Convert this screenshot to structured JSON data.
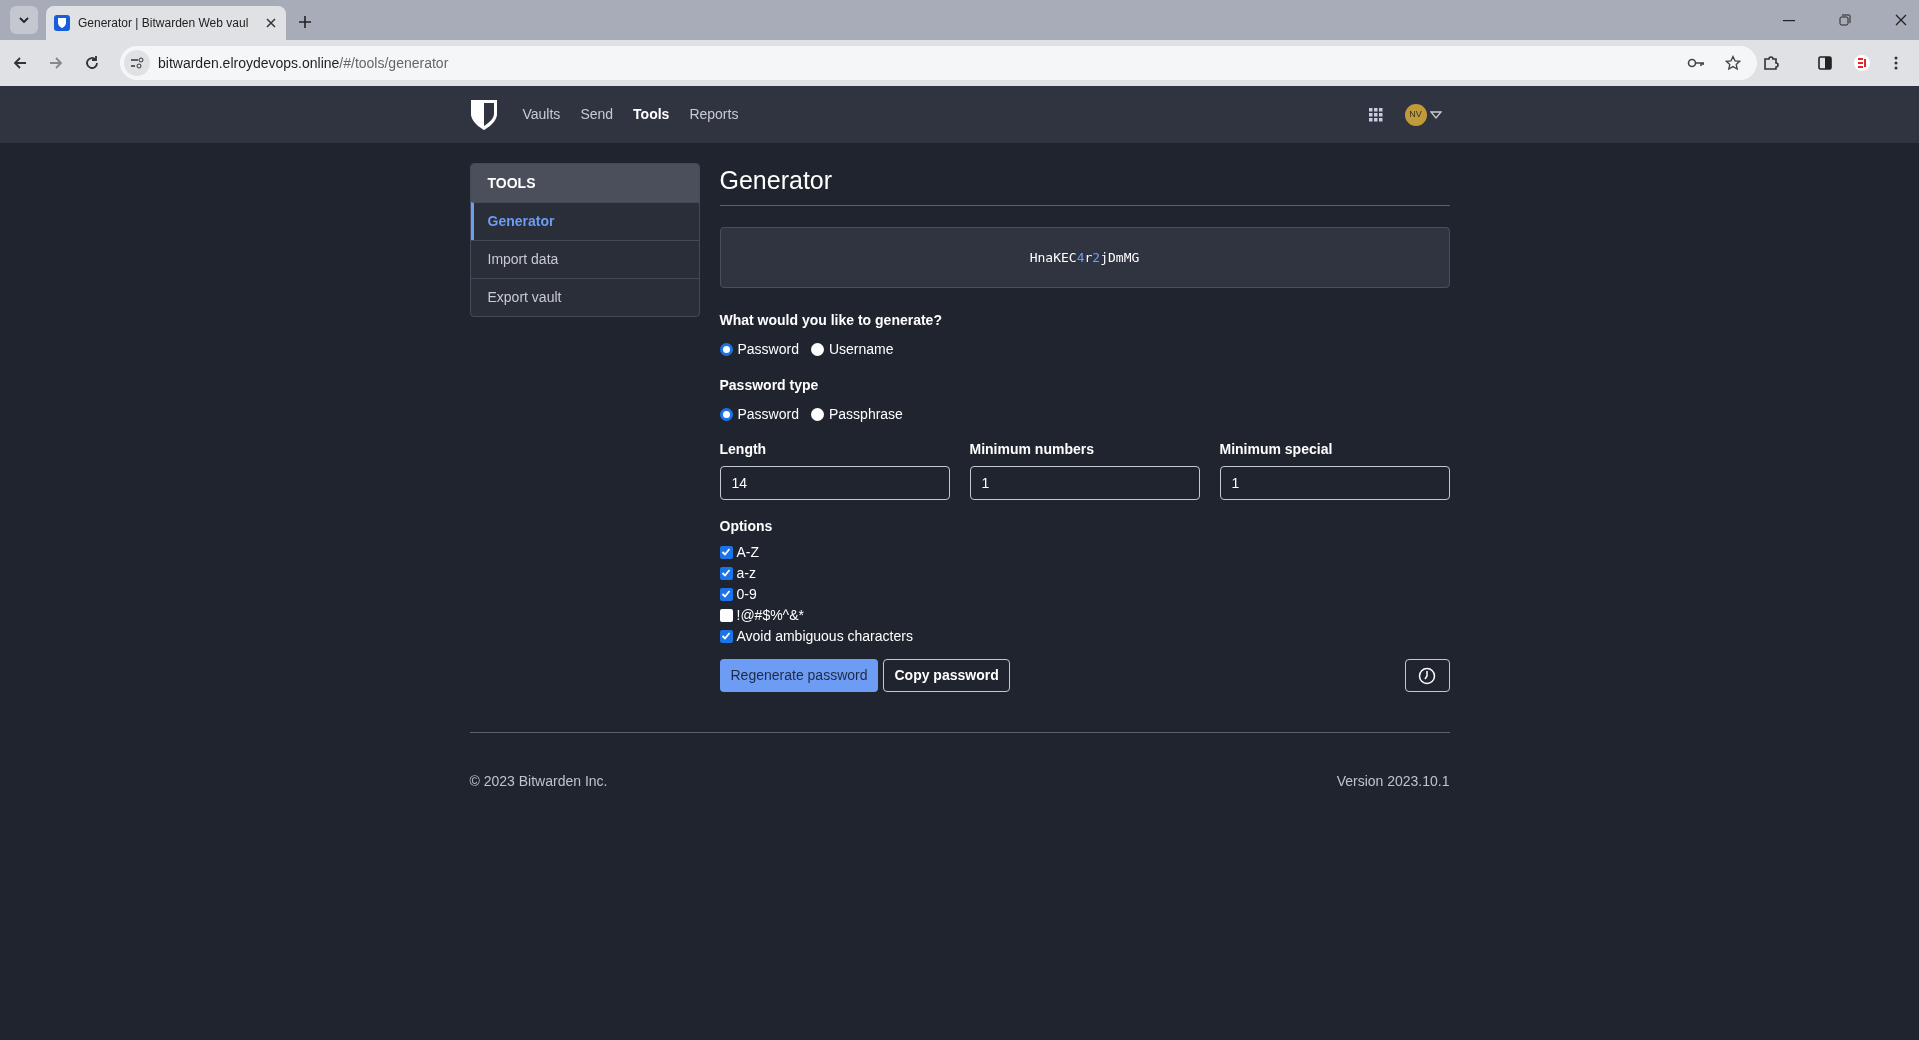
{
  "browser": {
    "tab_title": "Generator | Bitwarden Web vaul",
    "url_host": "bitwarden.elroydevops.online",
    "url_path": "/#/tools/generator"
  },
  "nav": {
    "items": [
      {
        "label": "Vaults",
        "selected": false
      },
      {
        "label": "Send",
        "selected": false
      },
      {
        "label": "Tools",
        "selected": true
      },
      {
        "label": "Reports",
        "selected": false
      }
    ],
    "avatar": "NV"
  },
  "sidebar": {
    "title": "TOOLS",
    "items": [
      {
        "label": "Generator",
        "selected": true
      },
      {
        "label": "Import data",
        "selected": false
      },
      {
        "label": "Export vault",
        "selected": false
      }
    ]
  },
  "page_title": "Generator",
  "generated_password": "HnaKEC4r2jDmMG",
  "generate_question": "What would you like to generate?",
  "generate_options": [
    {
      "label": "Password",
      "selected": true
    },
    {
      "label": "Username",
      "selected": false
    }
  ],
  "password_type_label": "Password type",
  "password_type_options": [
    {
      "label": "Password",
      "selected": true
    },
    {
      "label": "Passphrase",
      "selected": false
    }
  ],
  "fields": [
    {
      "label": "Length",
      "value": "14"
    },
    {
      "label": "Minimum numbers",
      "value": "1"
    },
    {
      "label": "Minimum special",
      "value": "1"
    }
  ],
  "options_label": "Options",
  "options": [
    {
      "label": "A-Z",
      "checked": true
    },
    {
      "label": "a-z",
      "checked": true
    },
    {
      "label": "0-9",
      "checked": true
    },
    {
      "label": "!@#$%^&*",
      "checked": false
    },
    {
      "label": "Avoid ambiguous characters",
      "checked": true
    }
  ],
  "buttons": {
    "regenerate": "Regenerate password",
    "copy": "Copy password"
  },
  "footer": {
    "copyright": "© 2023 Bitwarden Inc.",
    "version": "Version 2023.10.1"
  }
}
